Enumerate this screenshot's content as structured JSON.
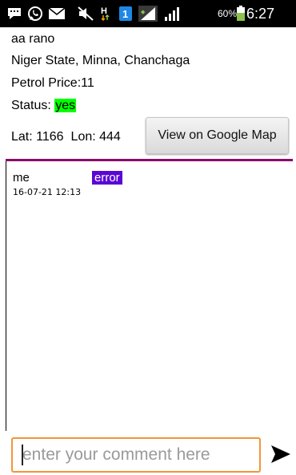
{
  "status_bar": {
    "battery_percent": "60%",
    "time": "6:27 PM",
    "network_type": "H",
    "sim_badge": "1",
    "icons": [
      "messaging-icon",
      "whatsapp-icon",
      "email-icon",
      "mute-icon",
      "data-activity-icon",
      "sim-icon",
      "signal-icon",
      "signal-icon",
      "battery-icon"
    ],
    "colors": {
      "sim_badge": "#1e88e5",
      "battery": "#8bc34a"
    }
  },
  "station": {
    "name": "aa rano",
    "address": "Niger State, Minna, Chanchaga",
    "price_label": "Petrol Price:11",
    "status_label": "Status: ",
    "status_value": "yes",
    "lat_label": "Lat: 1166",
    "lon_label": "Lon: 444"
  },
  "map_button": {
    "label": "View on Google Map"
  },
  "comments": [
    {
      "author": "me",
      "text": "error",
      "timestamp": "16-07-21 12:13"
    }
  ],
  "comment_input": {
    "value": "",
    "placeholder": "enter your comment here"
  },
  "send_button": {
    "icon": "send-icon"
  },
  "colors": {
    "status_highlight": "#00ff00",
    "divider": "#8b0a6e",
    "comment_highlight": "#5b06d4",
    "input_border": "#f0963a"
  }
}
